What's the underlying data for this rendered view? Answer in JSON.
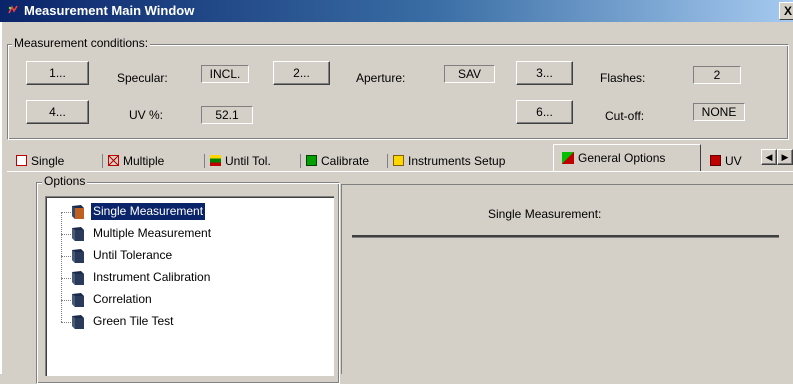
{
  "window": {
    "title": "Measurement Main Window",
    "close_label": "X"
  },
  "conditions": {
    "legend": "Measurement conditions:",
    "buttons": [
      "1...",
      "2...",
      "3...",
      "4...",
      "6..."
    ],
    "specular": {
      "label": "Specular:",
      "value": "INCL."
    },
    "aperture": {
      "label": "Aperture:",
      "value": "SAV"
    },
    "flashes": {
      "label": "Flashes:",
      "value": "2"
    },
    "uv": {
      "label": "UV %:",
      "value": "52.1"
    },
    "cutoff": {
      "label": "Cut-off:",
      "value": "NONE"
    }
  },
  "tabs": [
    {
      "label": "Single",
      "icon": "single-icon",
      "color": "#c00000"
    },
    {
      "label": "Multiple",
      "icon": "multiple-icon",
      "color": "#c00000"
    },
    {
      "label": "Until Tol.",
      "icon": "until-tol-icon",
      "color": "#008000"
    },
    {
      "label": "Calibrate",
      "icon": "calibrate-icon",
      "color": "#00a000"
    },
    {
      "label": "Instruments Setup",
      "icon": "instruments-icon",
      "color": "#c0a000"
    },
    {
      "label": "General Options",
      "icon": "general-options-icon",
      "color": "#008000",
      "active": true
    },
    {
      "label": "UV",
      "icon": "uv-icon",
      "color": "#c00000"
    }
  ],
  "options": {
    "legend": "Options",
    "items": [
      "Single Measurement",
      "Multiple Measurement",
      "Until Tolerance",
      "Instrument Calibration",
      "Correlation",
      "Green Tile Test"
    ],
    "selected_index": 0
  },
  "panel": {
    "title": "Single Measurement:"
  }
}
